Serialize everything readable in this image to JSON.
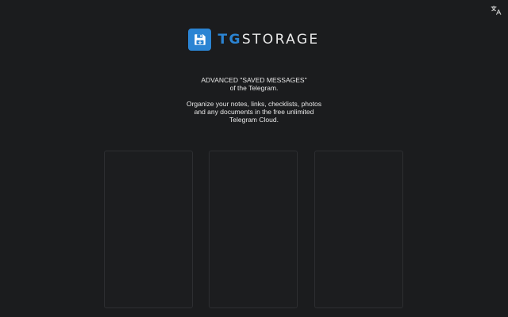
{
  "header": {
    "translate_icon": "translate-icon",
    "brand": {
      "logo_icon": "floppy-disk-icon",
      "name_accent": "TG",
      "name_rest": "STORAGE",
      "accent_color": "#2b84d3"
    }
  },
  "hero": {
    "line1": "ADVANCED \"SAVED MESSAGES\"",
    "line2": "of the Telegram.",
    "line3": "Organize your notes, links, checklists, photos",
    "line4": "and any documents in the free unlimited",
    "line5": "Telegram Cloud."
  },
  "cards": [
    {
      "id": "card-1"
    },
    {
      "id": "card-2"
    },
    {
      "id": "card-3"
    }
  ]
}
